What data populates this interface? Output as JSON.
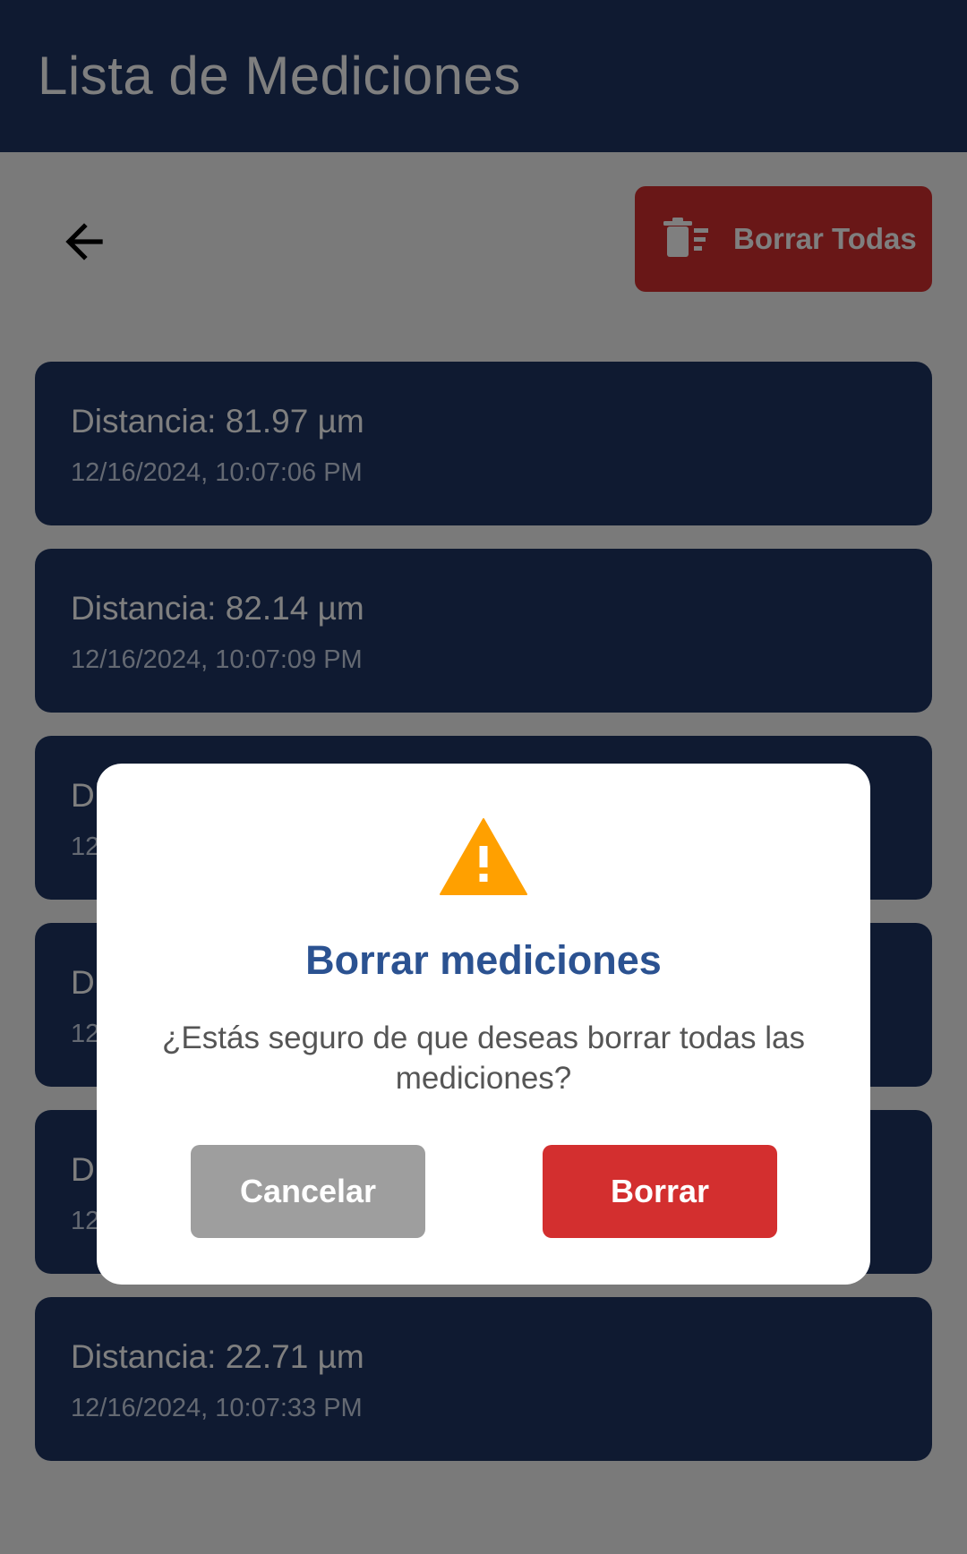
{
  "appbar": {
    "title": "Lista de Mediciones"
  },
  "toolbar": {
    "delete_all_label": "Borrar Todas"
  },
  "measurements": [
    {
      "distance": "Distancia: 81.97 µm",
      "timestamp": "12/16/2024, 10:07:06 PM"
    },
    {
      "distance": "Distancia: 82.14 µm",
      "timestamp": "12/16/2024, 10:07:09 PM"
    },
    {
      "distance": "Di",
      "timestamp": "12"
    },
    {
      "distance": "Di",
      "timestamp": "12"
    },
    {
      "distance": "Di",
      "timestamp": "12"
    },
    {
      "distance": "Distancia: 22.71 µm",
      "timestamp": "12/16/2024, 10:07:33 PM"
    }
  ],
  "dialog": {
    "icon": "warning-icon",
    "title": "Borrar mediciones",
    "message": "¿Estás seguro de que deseas borrar todas las mediciones?",
    "cancel_label": "Cancelar",
    "confirm_label": "Borrar"
  },
  "colors": {
    "primary": "#1f3563",
    "danger": "#d32f2f",
    "warning": "#ffa000",
    "dialog_title": "#2b5291",
    "cancel": "#9e9e9e"
  }
}
